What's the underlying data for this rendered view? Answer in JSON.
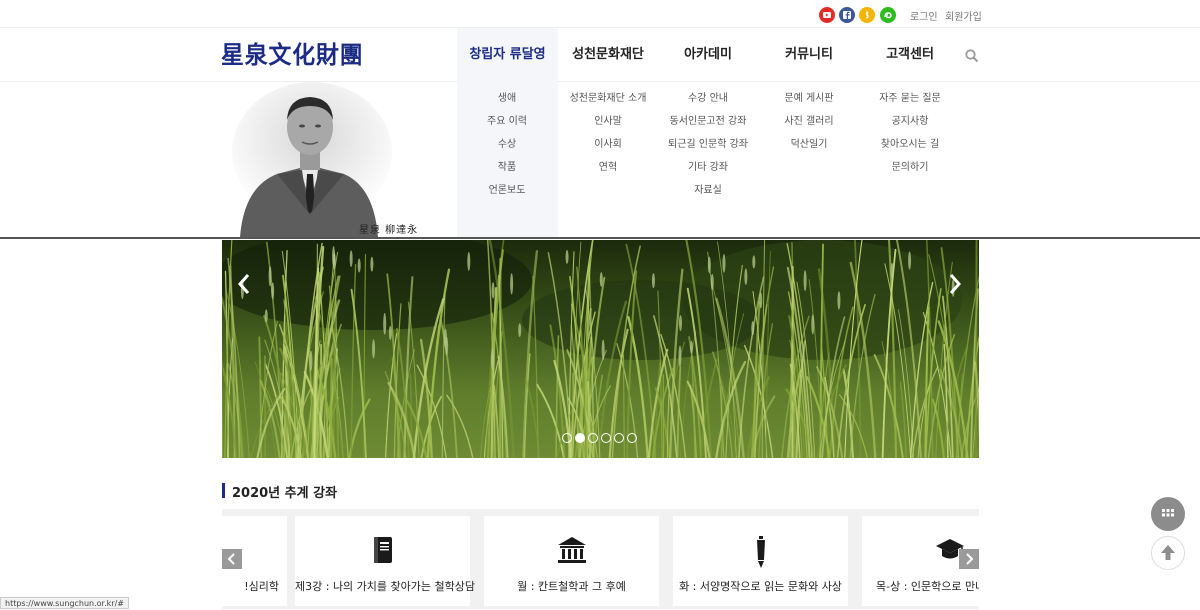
{
  "topbar": {
    "social": [
      {
        "name": "youtube-icon",
        "color": "#e52d27"
      },
      {
        "name": "facebook-icon",
        "color": "#3b5998"
      },
      {
        "name": "kakaostory-icon",
        "color": "#f5b400"
      },
      {
        "name": "band-icon",
        "color": "#2dbb21"
      }
    ],
    "login": "로그인",
    "signup": "회원가입"
  },
  "header": {
    "logo": "星泉文化財團",
    "nav": [
      "창립자 류달영",
      "성천문화재단",
      "아카데미",
      "커뮤니티",
      "고객센터"
    ],
    "active_index": 0
  },
  "dropdown": {
    "columns": [
      [
        "생애",
        "주요 이력",
        "수상",
        "작품",
        "언론보도"
      ],
      [
        "성천문화재단 소개",
        "인사말",
        "이사회",
        "연혁"
      ],
      [
        "수강 안내",
        "동서인문고전 강좌",
        "퇴근길 인문학 강좌",
        "기타 강좌",
        "자료실"
      ],
      [
        "문예 게시판",
        "사진 갤러리",
        "덕산일기"
      ],
      [
        "자주 묻는 질문",
        "공지사항",
        "찾아오시는 길",
        "문의하기"
      ]
    ],
    "portrait_caption": "星泉  柳達永"
  },
  "slider": {
    "total_slides": 6,
    "active_slide": 2
  },
  "section": {
    "title": "2020년 추계 강좌"
  },
  "cards": [
    {
      "title": "!심리학",
      "icon": "none"
    },
    {
      "title": "제3강 : 나의 가치를 찾아가는 철학상담",
      "icon": "book-icon"
    },
    {
      "title": "월 : 칸트철학과 그 후예",
      "icon": "museum-icon"
    },
    {
      "title": "화 : 서양명작으로 읽는 문화와 사상",
      "icon": "pen-icon"
    },
    {
      "title": "목-상 : 인문학으로 만나",
      "icon": "graduation-cap-icon"
    }
  ],
  "status_url": "https://www.sungchun.or.kr/#",
  "colors": {
    "brand": "#1b2b86",
    "dropdown_active_bg": "#f4f6f9"
  }
}
